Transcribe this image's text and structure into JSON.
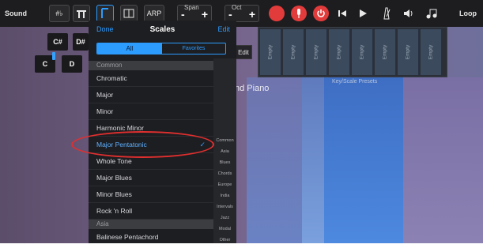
{
  "toolbar": {
    "sound_label": "Sound",
    "sharp_flat_label": "#♭",
    "arp_label": "ARP",
    "span_label": "Span",
    "oct_label": "Oct",
    "loop_label": "Loop"
  },
  "keys": [
    "C#",
    "D#",
    "C",
    "D"
  ],
  "edit_floating_label": "Edit",
  "background_title": "nd Piano",
  "presets": {
    "slots": [
      "Empty",
      "Empty",
      "Empty",
      "Empty",
      "Empty",
      "Empty",
      "Empty",
      "Empty"
    ],
    "caption": "Key/Scale Presets"
  },
  "scales_panel": {
    "done_label": "Done",
    "title": "Scales",
    "edit_label": "Edit",
    "segmented": {
      "all": "All",
      "favorites": "Favorites"
    },
    "sections": [
      {
        "header": "Common",
        "items": [
          "Chromatic",
          "Major",
          "Minor",
          "Harmonic Minor",
          "Major Pentatonic",
          "Whole Tone",
          "Major Blues",
          "Minor Blues",
          "Rock 'n Roll"
        ]
      },
      {
        "header": "Asia",
        "items": [
          "Balinese Pentachord"
        ]
      }
    ],
    "selected_item": "Major Pentatonic",
    "checkmark": "✓",
    "index": [
      "Common",
      "Asia",
      "Blues",
      "Chords",
      "Europe",
      "India",
      "Intervals",
      "Jazz",
      "Modal",
      "Other"
    ]
  },
  "colors": {
    "accent": "#2c9cff",
    "highlight_ring": "#e02f2f"
  }
}
